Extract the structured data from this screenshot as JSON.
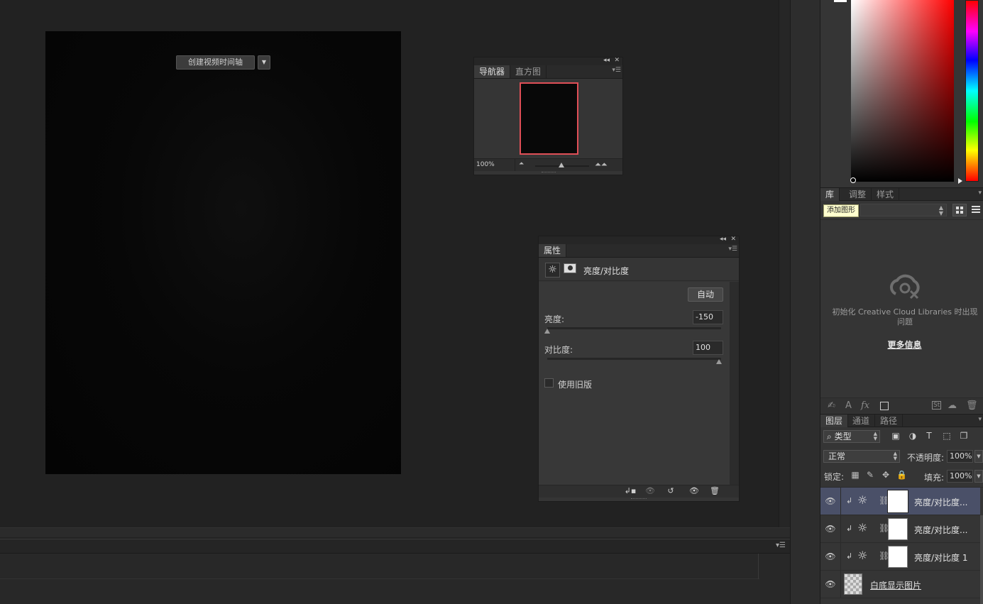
{
  "navigator": {
    "tabs": [
      "导航器",
      "直方图"
    ],
    "zoom": "100%",
    "collapse_icon": "double-chevron-left-icon",
    "close_icon": "close-icon"
  },
  "properties": {
    "tab": "属性",
    "title": "亮度/对比度",
    "auto_button": "自动",
    "brightness_label": "亮度:",
    "brightness_value": "-150",
    "contrast_label": "对比度:",
    "contrast_value": "100",
    "legacy_label": "使用旧版",
    "legacy_checked": false
  },
  "library": {
    "tabs": [
      "库",
      "调整",
      "样式"
    ],
    "tooltip": "添加图形",
    "message": "初始化 Creative Cloud Libraries 时出现问题",
    "more_info": "更多信息"
  },
  "layers": {
    "tabs": [
      "图层",
      "通道",
      "路径"
    ],
    "filter_kind": "类型",
    "blend_mode": "正常",
    "opacity_label": "不透明度:",
    "opacity_value": "100%",
    "lock_label": "锁定:",
    "fill_label": "填充:",
    "fill_value": "100%",
    "items": [
      {
        "name": "亮度/对比度...",
        "selected": true
      },
      {
        "name": "亮度/对比度...",
        "selected": false
      },
      {
        "name": "亮度/对比度 1",
        "selected": false
      },
      {
        "name": "白底显示图片",
        "selected": false
      }
    ]
  },
  "timeline": {
    "create_button": "创建视频时间轴"
  },
  "colors": {
    "accent_nav_frame": "#e04f57",
    "selected_layer": "#4a5068",
    "panel_bg": "#353535",
    "workspace_bg": "#222222"
  }
}
